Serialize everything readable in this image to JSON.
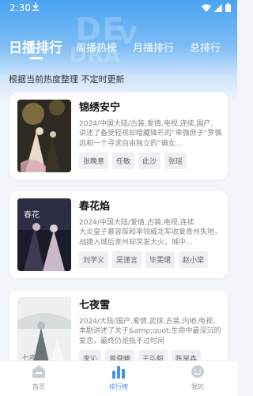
{
  "status_bar": {
    "time": "2:30"
  },
  "tabs": [
    {
      "label": "日播排行",
      "active": true
    },
    {
      "label": "周播热榜",
      "active": false
    },
    {
      "label": "月播排行",
      "active": false
    },
    {
      "label": "总排行",
      "active": false
    }
  ],
  "subtitle": "根据当前热度整理 不定时更新",
  "dramas": [
    {
      "title": "锦绣安宁",
      "meta": "2024/中国大陆/古装,爱情,电视,连续,国产,",
      "desc": "讲述了备受轻视却暗藏锋芒的“卑微庶子”罗慎远和一个寻求自由独立的“偏女...",
      "actors": [
        "张晚意",
        "任敏",
        "此沙",
        "张瑶"
      ],
      "poster_colors": [
        "#2c2a22",
        "#7d6a3f",
        "#e9dcc6"
      ]
    },
    {
      "title": "春花焰",
      "meta": "2024/中国大陆/爱情,古装,电视,连续",
      "desc": "大炎皇子慕容琛和率领威北军收复青州失地，战捷入城后青州却突发大火，城中...",
      "actors": [
        "刘学义",
        "吴谨言",
        "毕雯珺",
        "赵小棠"
      ],
      "poster_colors": [
        "#1a1c2c",
        "#3d3a52",
        "#c9b8c6"
      ]
    },
    {
      "title": "七夜雪",
      "meta": "2024/大陆/国产,爱情,武侠,古装,内地,电视,",
      "desc": "本剧讲述了关于&amp;quot;生命中最深沉的爱恋，最终仍是抵不过时间",
      "actors": [
        "李沁",
        "曾舜晞",
        "王弘毅",
        "陈昊森"
      ],
      "poster_colors": [
        "#eef0f0",
        "#d7dcdc",
        "#6d7478"
      ]
    }
  ],
  "bottom_nav": [
    {
      "label": "首页",
      "icon": "home-icon",
      "active": false
    },
    {
      "label": "排行榜",
      "icon": "ranking-chart-icon",
      "active": true
    },
    {
      "label": "我的",
      "icon": "profile-face-icon",
      "active": false
    }
  ],
  "colors": {
    "accent": "#4a90e2",
    "header": "#4aa3f2"
  }
}
